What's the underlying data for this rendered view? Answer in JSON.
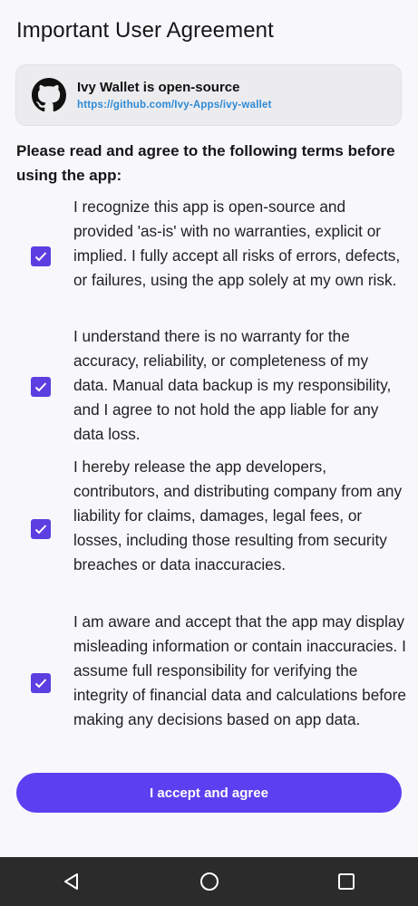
{
  "header": {
    "title": "Important User Agreement"
  },
  "repo_card": {
    "title": "Ivy Wallet is open-source",
    "link": "https://github.com/Ivy-Apps/ivy-wallet",
    "icon": "github-icon"
  },
  "intro": "Please read and agree to the following terms before using the app:",
  "terms": [
    {
      "checked": true,
      "text": "I recognize this app is open-source and provided 'as-is' with no warranties, explicit or implied. I fully accept all risks of errors, defects, or failures, using the app solely at my own risk."
    },
    {
      "checked": true,
      "text": "I understand there is no warranty for the accuracy, reliability, or completeness of my data. Manual data backup is my responsibility, and I agree to not hold the app liable for any data loss."
    },
    {
      "checked": true,
      "text": "I hereby release the app developers, contributors, and distributing company from any liability for claims, damages, legal fees, or losses, including those resulting from security breaches or data inaccuracies."
    },
    {
      "checked": true,
      "text": "I am aware and accept that the app may display misleading information or contain inaccuracies. I assume full responsibility for verifying the integrity of financial data and calculations before making any decisions based on app data."
    }
  ],
  "accept_button": {
    "label": "I accept and agree"
  },
  "colors": {
    "accent": "#5c3ff0",
    "background": "#f8f7fc",
    "link": "#2d8ad6",
    "navbar": "#2b2b2b"
  },
  "navbar": {
    "buttons": [
      "back-icon",
      "home-icon",
      "recents-icon"
    ]
  }
}
